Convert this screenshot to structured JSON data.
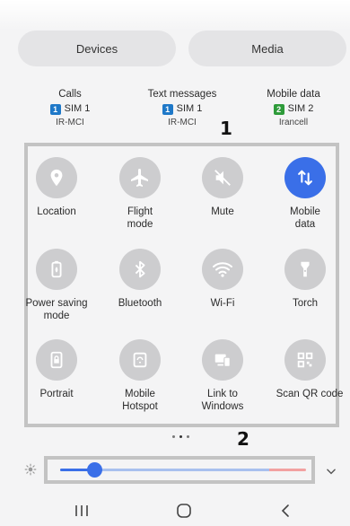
{
  "header": {
    "devices_label": "Devices",
    "media_label": "Media"
  },
  "sim_info": [
    {
      "title": "Calls",
      "sim": "SIM 1",
      "sim_number": "1",
      "carrier": "IR-MCI",
      "badge_color": "#1e78c8"
    },
    {
      "title": "Text messages",
      "sim": "SIM 1",
      "sim_number": "1",
      "carrier": "IR-MCI",
      "badge_color": "#1e78c8"
    },
    {
      "title": "Mobile data",
      "sim": "SIM 2",
      "sim_number": "2",
      "carrier": "Irancell",
      "badge_color": "#2e9b3a"
    }
  ],
  "annotations": {
    "one": "1",
    "two": "2"
  },
  "quick_settings": [
    {
      "label": "Location",
      "icon": "location-pin-icon",
      "active": false
    },
    {
      "label": "Flight\nmode",
      "icon": "airplane-icon",
      "active": false
    },
    {
      "label": "Mute",
      "icon": "mute-icon",
      "active": false
    },
    {
      "label": "Mobile\ndata",
      "icon": "data-arrows-icon",
      "active": true
    },
    {
      "label": "Power saving\nmode",
      "icon": "battery-saver-icon",
      "active": false
    },
    {
      "label": "Bluetooth",
      "icon": "bluetooth-icon",
      "active": false
    },
    {
      "label": "Wi-Fi",
      "icon": "wifi-icon",
      "active": false
    },
    {
      "label": "Torch",
      "icon": "torch-icon",
      "active": false
    },
    {
      "label": "Portrait",
      "icon": "portrait-lock-icon",
      "active": false
    },
    {
      "label": "Mobile\nHotspot",
      "icon": "hotspot-icon",
      "active": false
    },
    {
      "label": "Link to\nWindows",
      "icon": "link-to-windows-icon",
      "active": false
    },
    {
      "label": "Scan QR code",
      "icon": "qr-code-icon",
      "active": false
    }
  ],
  "pagination": {
    "pages": 3,
    "current": 2
  },
  "brightness": {
    "level": 0.14
  },
  "colors": {
    "accent": "#3a6fe8",
    "tile_off": "#cdcdcf",
    "frame": "#c3c3c3"
  }
}
